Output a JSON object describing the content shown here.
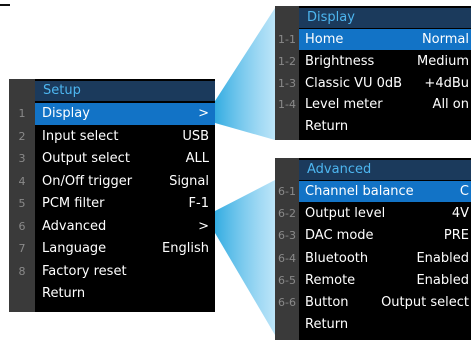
{
  "setup": {
    "title": "Setup",
    "items": [
      {
        "num": "1",
        "label": "Display",
        "value": ">",
        "selected": true
      },
      {
        "num": "2",
        "label": "Input select",
        "value": "USB"
      },
      {
        "num": "3",
        "label": "Output select",
        "value": "ALL"
      },
      {
        "num": "4",
        "label": "On/Off trigger",
        "value": "Signal"
      },
      {
        "num": "5",
        "label": "PCM filter",
        "value": "F-1"
      },
      {
        "num": "6",
        "label": "Advanced",
        "value": ">"
      },
      {
        "num": "7",
        "label": "Language",
        "value": "English"
      },
      {
        "num": "8",
        "label": "Factory reset",
        "value": ""
      },
      {
        "num": "",
        "label": "Return",
        "value": ""
      }
    ]
  },
  "display": {
    "title": "Display",
    "items": [
      {
        "num": "1-1",
        "label": "Home",
        "value": "Normal",
        "selected": true
      },
      {
        "num": "1-2",
        "label": "Brightness",
        "value": "Medium"
      },
      {
        "num": "1-3",
        "label": "Classic VU 0dB",
        "value": "+4dBu"
      },
      {
        "num": "1-4",
        "label": "Level meter",
        "value": "All on"
      },
      {
        "num": "",
        "label": "Return",
        "value": ""
      }
    ]
  },
  "advanced": {
    "title": "Advanced",
    "items": [
      {
        "num": "6-1",
        "label": "Channel balance",
        "value": "C",
        "selected": true
      },
      {
        "num": "6-2",
        "label": "Output level",
        "value": "4V"
      },
      {
        "num": "6-3",
        "label": "DAC mode",
        "value": "PRE"
      },
      {
        "num": "6-4",
        "label": "Bluetooth",
        "value": "Enabled"
      },
      {
        "num": "6-5",
        "label": "Remote",
        "value": "Enabled"
      },
      {
        "num": "6-6",
        "label": "Button",
        "value": "Output select"
      },
      {
        "num": "",
        "label": "Return",
        "value": ""
      }
    ]
  },
  "colors": {
    "highlight": "#1273c6",
    "title_bar": "#1b3a5c",
    "title_text": "#4db6f0",
    "beam": "#29a8e0"
  }
}
